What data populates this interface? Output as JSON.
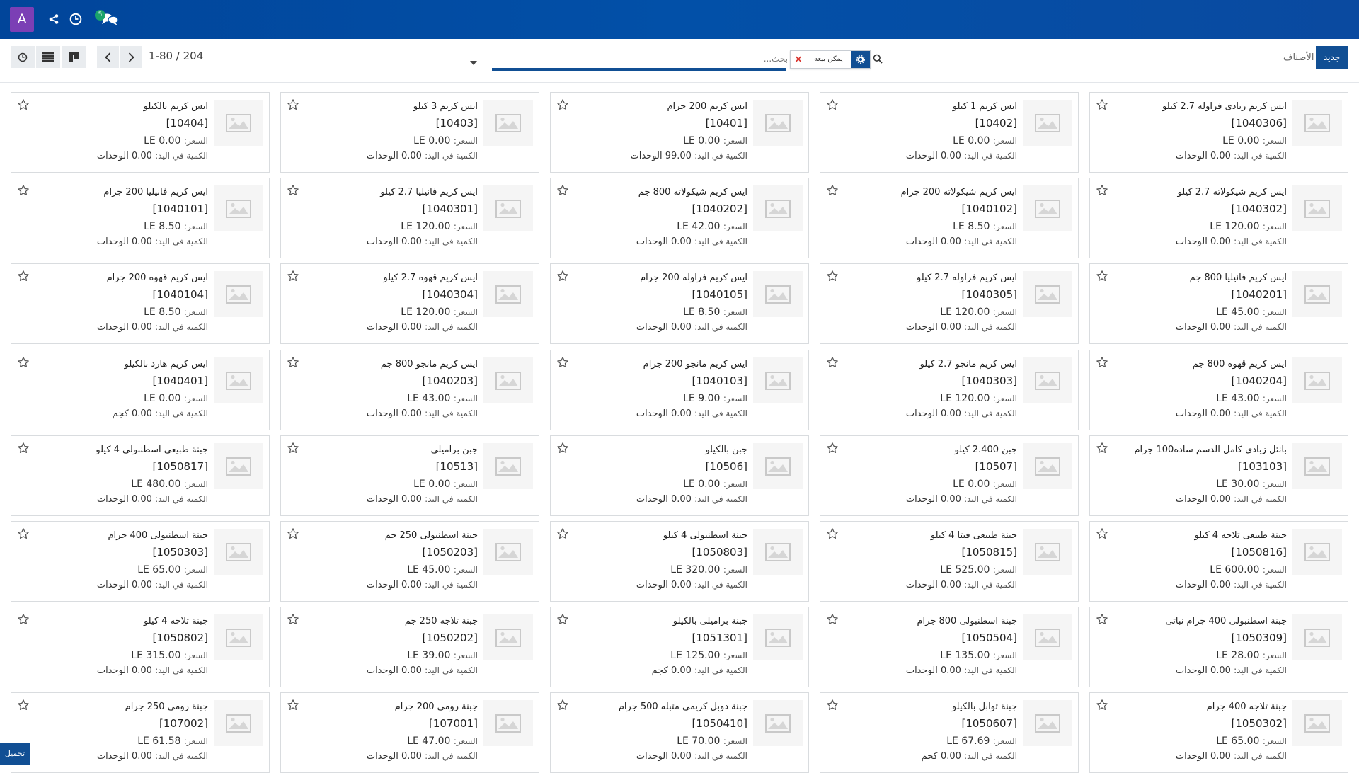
{
  "navbar": {
    "avatar_letter": "A",
    "icons": [
      "share-icon",
      "clock-icon",
      "chat-icon"
    ],
    "chat_badge": "5"
  },
  "control": {
    "pager": "1-80 / 204",
    "views": [
      "activity-icon",
      "list-icon",
      "kanban-icon"
    ],
    "search": {
      "placeholder": "بحث...",
      "facet_label": "يمكن بيعه"
    },
    "breadcrumb": "الأصناف",
    "new_button": "جديد"
  },
  "labels": {
    "price": "السعر:",
    "qty": "الكمية في اليد:"
  },
  "accent_color": "#114f94",
  "cards": [
    {
      "name": "ايس كريم زبادى فراوله 2.7 كيلو",
      "code": "[1040306]",
      "price": "LE 0.00",
      "qty": "0.00 الوحدات"
    },
    {
      "name": "ايس كريم 1 كيلو",
      "code": "[10402]",
      "price": "LE 0.00",
      "qty": "0.00 الوحدات"
    },
    {
      "name": "ايس كريم 200 جرام",
      "code": "[10401]",
      "price": "LE 0.00",
      "qty": "99.00 الوحدات"
    },
    {
      "name": "ايس كريم 3 كيلو",
      "code": "[10403]",
      "price": "LE 0.00",
      "qty": "0.00 الوحدات"
    },
    {
      "name": "ايس كريم بالكيلو",
      "code": "[10404]",
      "price": "LE 0.00",
      "qty": "0.00 الوحدات"
    },
    {
      "name": "ايس كريم شيكولاته 2.7 كيلو",
      "code": "[1040302]",
      "price": "LE 120.00",
      "qty": "0.00 الوحدات"
    },
    {
      "name": "ايس كريم شيكولاته 200 جرام",
      "code": "[1040102]",
      "price": "LE 8.50",
      "qty": "0.00 الوحدات"
    },
    {
      "name": "ايس كريم شيكولاته 800 جم",
      "code": "[1040202]",
      "price": "LE 42.00",
      "qty": "0.00 الوحدات"
    },
    {
      "name": "ايس كريم فانيليا 2.7 كيلو",
      "code": "[1040301]",
      "price": "LE 120.00",
      "qty": "0.00 الوحدات"
    },
    {
      "name": "ايس كريم فانيليا 200 جرام",
      "code": "[1040101]",
      "price": "LE 8.50",
      "qty": "0.00 الوحدات"
    },
    {
      "name": "ايس كريم فانيليا 800 جم",
      "code": "[1040201]",
      "price": "LE 45.00",
      "qty": "0.00 الوحدات"
    },
    {
      "name": "ايس كريم فراوله 2.7 كيلو",
      "code": "[1040305]",
      "price": "LE 120.00",
      "qty": "0.00 الوحدات"
    },
    {
      "name": "ايس كريم فراوله 200 جرام",
      "code": "[1040105]",
      "price": "LE 8.50",
      "qty": "0.00 الوحدات"
    },
    {
      "name": "ايس كريم قهوه 2.7 كيلو",
      "code": "[1040304]",
      "price": "LE 120.00",
      "qty": "0.00 الوحدات"
    },
    {
      "name": "ايس كريم قهوه 200 جرام",
      "code": "[1040104]",
      "price": "LE 8.50",
      "qty": "0.00 الوحدات"
    },
    {
      "name": "ايس كريم قهوه 800 جم",
      "code": "[1040204]",
      "price": "LE 43.00",
      "qty": "0.00 الوحدات"
    },
    {
      "name": "ايس كريم مانجو 2.7 كيلو",
      "code": "[1040303]",
      "price": "LE 120.00",
      "qty": "0.00 الوحدات"
    },
    {
      "name": "ايس كريم مانجو 200 جرام",
      "code": "[1040103]",
      "price": "LE 9.00",
      "qty": "0.00 الوحدات"
    },
    {
      "name": "ايس كريم مانجو 800 جم",
      "code": "[1040203]",
      "price": "LE 43.00",
      "qty": "0.00 الوحدات"
    },
    {
      "name": "ايس كريم هارد بالكيلو",
      "code": "[1040401]",
      "price": "LE 0.00",
      "qty": "0.00 كجم"
    },
    {
      "name": "بانئل زبادى كامل الدسم ساده100 جرام",
      "code": "[103103]",
      "price": "LE 30.00",
      "qty": "0.00 الوحدات"
    },
    {
      "name": "جبن 2.400 كيلو",
      "code": "[10507]",
      "price": "LE 0.00",
      "qty": "0.00 الوحدات"
    },
    {
      "name": "جبن بالكيلو",
      "code": "[10506]",
      "price": "LE 0.00",
      "qty": "0.00 الوحدات"
    },
    {
      "name": "جبن برامیلی",
      "code": "[10513]",
      "price": "LE 0.00",
      "qty": "0.00 الوحدات"
    },
    {
      "name": "جبنة طبيعى اسطنبولى 4 كيلو",
      "code": "[1050817]",
      "price": "LE 480.00",
      "qty": "0.00 الوحدات"
    },
    {
      "name": "جبنة طبيعى تلاجه 4 كيلو",
      "code": "[1050816]",
      "price": "LE 600.00",
      "qty": "0.00 الوحدات"
    },
    {
      "name": "جبنة طبيعى فيتا 4 كيلو",
      "code": "[1050815]",
      "price": "LE 525.00",
      "qty": "0.00 الوحدات"
    },
    {
      "name": "جبنة اسطنبولى 4 كيلو",
      "code": "[1050803]",
      "price": "LE 320.00",
      "qty": "0.00 الوحدات"
    },
    {
      "name": "جبنة اسطنبولى 250 جم",
      "code": "[1050203]",
      "price": "LE 45.00",
      "qty": "0.00 الوحدات"
    },
    {
      "name": "جبنة اسطنبولى 400 جرام",
      "code": "[1050303]",
      "price": "LE 65.00",
      "qty": "0.00 الوحدات"
    },
    {
      "name": "جبنة اسطنبولى 400 جرام نباتى",
      "code": "[1050309]",
      "price": "LE 28.00",
      "qty": "0.00 الوحدات"
    },
    {
      "name": "جبنة اسطنبولى 800 جرام",
      "code": "[1050504]",
      "price": "LE 135.00",
      "qty": "0.00 الوحدات"
    },
    {
      "name": "جبنة برامیلی بالكيلو",
      "code": "[1051301]",
      "price": "LE 125.00",
      "qty": "0.00 كجم"
    },
    {
      "name": "جبنة تلاجه 250 جم",
      "code": "[1050202]",
      "price": "LE 39.00",
      "qty": "0.00 الوحدات"
    },
    {
      "name": "جبنة تلاجه 4 كيلو",
      "code": "[1050802]",
      "price": "LE 315.00",
      "qty": "0.00 الوحدات"
    },
    {
      "name": "جبنة تلاجه 400 جرام",
      "code": "[1050302]",
      "price": "LE 65.00",
      "qty": "0.00 الوحدات"
    },
    {
      "name": "جبنة توابل بالكيلو",
      "code": "[1050607]",
      "price": "LE 67.69",
      "qty": "0.00 كجم"
    },
    {
      "name": "جبنة دوبل كريمى متبله 500 جرام",
      "code": "[1050410]",
      "price": "LE 70.00",
      "qty": "0.00 الوحدات"
    },
    {
      "name": "جبنة رومى 200 جرام",
      "code": "[107001]",
      "price": "LE 47.00",
      "qty": "0.00 الوحدات"
    },
    {
      "name": "جبنة رومى 250 جرام",
      "code": "[107002]",
      "price": "LE 61.58",
      "qty": "0.00 الوحدات"
    }
  ],
  "load_button": "تحميل"
}
